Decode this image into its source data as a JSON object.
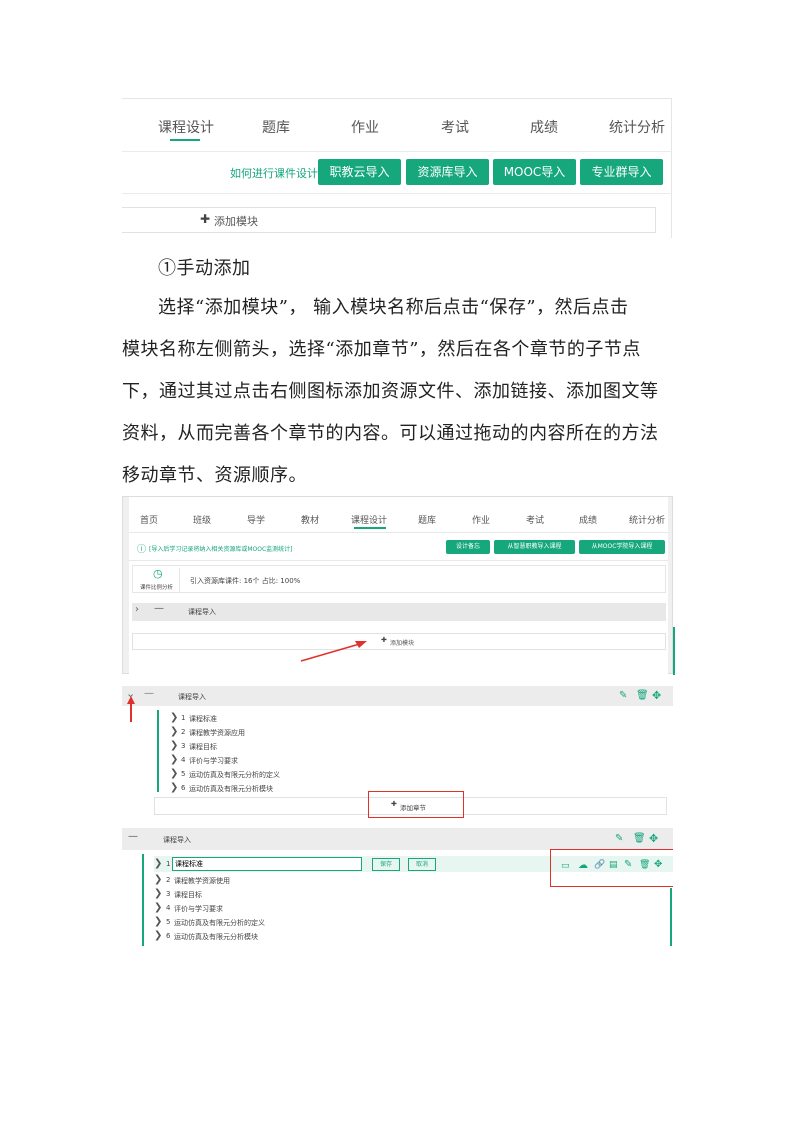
{
  "screenshot1": {
    "tabs": [
      "课程设计",
      "题库",
      "作业",
      "考试",
      "成绩",
      "统计分析"
    ],
    "active_tab": "课程设计",
    "help_link": "如何进行课件设计？",
    "import_buttons": [
      "职教云导入",
      "资源库导入",
      "MOOC导入",
      "专业群导入"
    ],
    "add_module": "添加模块"
  },
  "text": {
    "heading": "①手动添加",
    "lines": [
      "选择“添加模块”， 输入模块名称后点击“保存”，然后点击",
      "模块名称左侧箭头，选择“添加章节”，然后在各个章节的子节点",
      "下，通过其过点击右侧图标添加资源文件、添加链接、添加图文等",
      "资料，从而完善各个章节的内容。可以通过拖动的内容所在的方法",
      "移动章节、资源顺序。"
    ]
  },
  "screenshot2": {
    "tabs": [
      "首页",
      "班级",
      "导学",
      "教材",
      "课程设计",
      "题库",
      "作业",
      "考试",
      "成绩",
      "统计分析"
    ],
    "active_tab": "课程设计",
    "notice": "[导入后学习记录将纳入相关资源库或MOOC监测统计]",
    "buttons": [
      "设计备忘",
      "从智慧职教导入课程",
      "从MOOC学院导入课程"
    ],
    "stats_label": "课件比例分析",
    "stats_text": "引入资源库课件: 16个  占比: 100%",
    "module_name": "课程导入",
    "add_module": "添加模块"
  },
  "screenshot3": {
    "module_name": "课程导入",
    "chapters": [
      {
        "num": "1",
        "name": "课程标准"
      },
      {
        "num": "2",
        "name": "课程教学资源应用"
      },
      {
        "num": "3",
        "name": "课程目标"
      },
      {
        "num": "4",
        "name": "评价与学习要求"
      },
      {
        "num": "5",
        "name": "运动仿真及有限元分析的定义"
      },
      {
        "num": "6",
        "name": "运动仿真及有限元分析模块"
      }
    ],
    "add_chapter": "添加章节"
  },
  "screenshot4": {
    "module_name": "课程导入",
    "edit_value": "课程标准",
    "save": "保存",
    "cancel": "取消",
    "chapters": [
      {
        "num": "1",
        "name": ""
      },
      {
        "num": "2",
        "name": "课程教学资源使用"
      },
      {
        "num": "3",
        "name": "课程目标"
      },
      {
        "num": "4",
        "name": "评价与学习要求"
      },
      {
        "num": "5",
        "name": "运动仿真及有限元分析的定义"
      },
      {
        "num": "6",
        "name": "运动仿真及有限元分析模块"
      }
    ]
  },
  "colors": {
    "accent": "#16a77d",
    "highlight": "#e0322d"
  },
  "icons": [
    "plus-icon",
    "clock-icon",
    "chevron-right-icon",
    "chevron-down-icon",
    "edit-icon",
    "trash-icon",
    "move-icon",
    "folder-icon",
    "upload-cloud-icon",
    "link-icon",
    "document-icon",
    "info-icon"
  ]
}
